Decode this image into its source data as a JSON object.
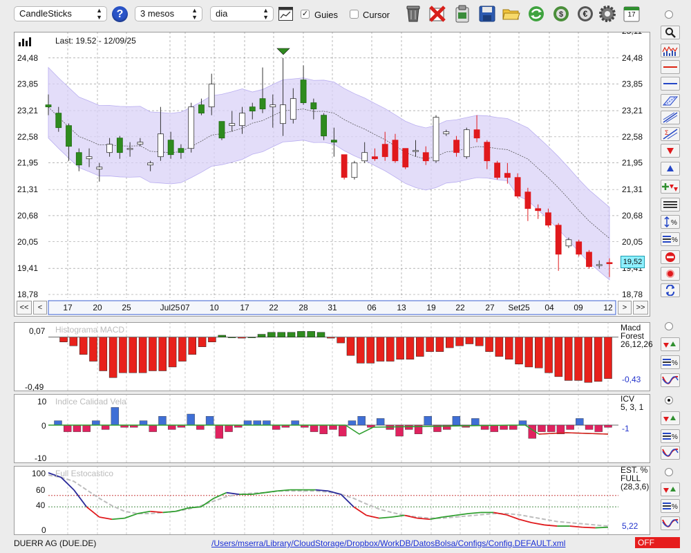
{
  "toolbar": {
    "chart_type": "CandleSticks",
    "period": "3 mesos",
    "interval": "dia",
    "guides_label": "Guies",
    "guides_checked": true,
    "cursor_label": "Cursor",
    "cursor_checked": false,
    "calendar_day": "17"
  },
  "main_chart": {
    "last_label": "Last: 19.52 - 12/09/25",
    "price_badge": "19,52",
    "y_ticks": [
      "24,48",
      "23,85",
      "23,21",
      "22,58",
      "21,95",
      "21,31",
      "20,68",
      "20,05",
      "19,41",
      "18,78"
    ],
    "y_top_partial": "25,11",
    "x_ticks": [
      "17",
      "20",
      "25",
      "Jul25",
      "07",
      "10",
      "17",
      "22",
      "28",
      "31",
      "06",
      "13",
      "19",
      "22",
      "27",
      "Set25",
      "04",
      "09",
      "12"
    ],
    "nav": {
      "first": "<<",
      "prev": "<",
      "next": ">",
      "last": ">>"
    }
  },
  "macd": {
    "title": "Histograma MACD",
    "top": "0,07",
    "bottom": "-0,49",
    "legend1": "Macd",
    "legend2": "Forest",
    "params": "26,12,26",
    "value": "-0,43"
  },
  "icv": {
    "title": "Indice Calidad Vela",
    "ticks": [
      "10",
      "0",
      "-10"
    ],
    "legend1": "ICV",
    "params": "5, 3, 1",
    "value": "-1"
  },
  "stoch": {
    "title": "Full Estocastico",
    "ticks": [
      "100",
      "60",
      "40",
      "0"
    ],
    "legend1": "EST. %",
    "legend2": "FULL",
    "params": "(28,3,6)",
    "value": "5,22"
  },
  "status": {
    "ticker": "DUERR AG (DUE.DE)",
    "path": "/Users/mserra/Library/CloudStorage/Dropbox/WorkDB/DatosBolsa/Configs/Config.DEFAULT.xml",
    "off": "OFF"
  },
  "colors": {
    "up": "#2e8b1e",
    "down": "#e0191c",
    "band": "#d9d2f7",
    "macd": "#e8211b",
    "icv_pos": "#3f6fd6",
    "icv_neg": "#e0225f"
  },
  "chart_data": [
    {
      "type": "candlestick",
      "ylim": [
        18.78,
        25.11
      ],
      "candles": [
        {
          "o": 23.35,
          "c": 23.3,
          "h": 23.6,
          "l": 23.1
        },
        {
          "o": 23.15,
          "c": 22.8,
          "h": 23.3,
          "l": 22.7
        },
        {
          "o": 22.85,
          "c": 22.35,
          "h": 22.9,
          "l": 22.0
        },
        {
          "o": 22.2,
          "c": 21.9,
          "h": 22.3,
          "l": 21.75
        },
        {
          "o": 22.05,
          "c": 22.1,
          "h": 22.3,
          "l": 21.85
        },
        {
          "o": 21.8,
          "c": 21.85,
          "h": 21.95,
          "l": 21.5
        },
        {
          "o": 22.2,
          "c": 22.4,
          "h": 22.55,
          "l": 22.1
        },
        {
          "o": 22.55,
          "c": 22.2,
          "h": 22.6,
          "l": 22.05
        },
        {
          "o": 22.3,
          "c": 22.3,
          "h": 22.45,
          "l": 22.1
        },
        {
          "o": 22.4,
          "c": 22.45,
          "h": 22.55,
          "l": 22.35
        },
        {
          "o": 21.9,
          "c": 21.95,
          "h": 22.0,
          "l": 21.75
        },
        {
          "o": 22.1,
          "c": 22.65,
          "h": 23.3,
          "l": 22.0
        },
        {
          "o": 22.5,
          "c": 22.15,
          "h": 22.7,
          "l": 22.05
        },
        {
          "o": 22.3,
          "c": 22.2,
          "h": 22.4,
          "l": 22.05
        },
        {
          "o": 22.3,
          "c": 23.3,
          "h": 23.4,
          "l": 22.2
        },
        {
          "o": 23.35,
          "c": 23.15,
          "h": 23.5,
          "l": 23.1
        },
        {
          "o": 23.3,
          "c": 23.85,
          "h": 24.1,
          "l": 23.1
        },
        {
          "o": 22.95,
          "c": 22.55,
          "h": 22.9,
          "l": 22.5
        },
        {
          "o": 22.85,
          "c": 22.9,
          "h": 23.2,
          "l": 22.7
        },
        {
          "o": 22.85,
          "c": 23.15,
          "h": 23.3,
          "l": 22.65
        },
        {
          "o": 23.3,
          "c": 23.2,
          "h": 23.4,
          "l": 23.0
        },
        {
          "o": 23.5,
          "c": 23.25,
          "h": 24.25,
          "l": 23.15
        },
        {
          "o": 23.3,
          "c": 23.35,
          "h": 23.6,
          "l": 22.8
        },
        {
          "o": 22.9,
          "c": 23.35,
          "h": 24.48,
          "l": 22.6
        },
        {
          "o": 23.0,
          "c": 23.5,
          "h": 23.75,
          "l": 22.9
        },
        {
          "o": 23.95,
          "c": 23.4,
          "h": 24.3,
          "l": 23.35
        },
        {
          "o": 23.4,
          "c": 23.25,
          "h": 23.5,
          "l": 23.0
        },
        {
          "o": 23.1,
          "c": 22.6,
          "h": 23.15,
          "l": 22.5
        },
        {
          "o": 22.5,
          "c": 22.45,
          "h": 22.8,
          "l": 22.1
        },
        {
          "o": 22.15,
          "c": 21.6,
          "h": 22.15,
          "l": 21.55
        },
        {
          "o": 21.6,
          "c": 21.95,
          "h": 22.0,
          "l": 21.55
        },
        {
          "o": 22.0,
          "c": 22.2,
          "h": 22.45,
          "l": 21.95
        },
        {
          "o": 22.1,
          "c": 22.05,
          "h": 22.3,
          "l": 22.0
        },
        {
          "o": 22.4,
          "c": 22.1,
          "h": 22.7,
          "l": 22.0
        },
        {
          "o": 22.5,
          "c": 22.0,
          "h": 22.65,
          "l": 21.95
        },
        {
          "o": 22.3,
          "c": 21.85,
          "h": 22.3,
          "l": 21.8
        },
        {
          "o": 22.25,
          "c": 22.25,
          "h": 22.5,
          "l": 22.1
        },
        {
          "o": 22.2,
          "c": 22.0,
          "h": 22.35,
          "l": 21.9
        },
        {
          "o": 22.0,
          "c": 23.05,
          "h": 23.1,
          "l": 21.95
        },
        {
          "o": 22.65,
          "c": 22.7,
          "h": 22.75,
          "l": 22.6
        },
        {
          "o": 22.5,
          "c": 22.2,
          "h": 22.6,
          "l": 22.1
        },
        {
          "o": 22.1,
          "c": 22.75,
          "h": 22.8,
          "l": 22.05
        },
        {
          "o": 22.75,
          "c": 22.55,
          "h": 23.1,
          "l": 22.45
        },
        {
          "o": 22.45,
          "c": 22.0,
          "h": 22.5,
          "l": 21.8
        },
        {
          "o": 21.95,
          "c": 21.6,
          "h": 22.0,
          "l": 21.55
        },
        {
          "o": 21.7,
          "c": 21.6,
          "h": 21.95,
          "l": 21.45
        },
        {
          "o": 21.6,
          "c": 21.15,
          "h": 21.7,
          "l": 21.1
        },
        {
          "o": 21.25,
          "c": 20.85,
          "h": 21.35,
          "l": 20.55
        },
        {
          "o": 20.85,
          "c": 20.8,
          "h": 20.95,
          "l": 20.6
        },
        {
          "o": 20.75,
          "c": 20.45,
          "h": 20.85,
          "l": 20.4
        },
        {
          "o": 20.45,
          "c": 19.75,
          "h": 20.5,
          "l": 19.35
        },
        {
          "o": 19.95,
          "c": 20.1,
          "h": 20.15,
          "l": 19.9
        },
        {
          "o": 20.05,
          "c": 19.75,
          "h": 20.1,
          "l": 19.7
        },
        {
          "o": 19.8,
          "c": 19.45,
          "h": 19.85,
          "l": 19.4
        },
        {
          "o": 19.5,
          "c": 19.5,
          "h": 19.6,
          "l": 19.4
        },
        {
          "o": 19.55,
          "c": 19.52,
          "h": 19.65,
          "l": 19.2
        }
      ]
    },
    {
      "type": "bar",
      "title": "Histograma MACD",
      "ylim": [
        -0.49,
        0.07
      ],
      "values": [
        -0.05,
        -0.09,
        -0.18,
        -0.25,
        -0.35,
        -0.42,
        -0.37,
        -0.37,
        -0.37,
        -0.35,
        -0.35,
        -0.31,
        -0.25,
        -0.18,
        -0.1,
        -0.05,
        0.02,
        0.0,
        -0.01,
        0.0,
        0.03,
        0.05,
        0.05,
        0.05,
        0.06,
        0.06,
        0.05,
        -0.01,
        -0.06,
        -0.19,
        -0.27,
        -0.27,
        -0.25,
        -0.25,
        -0.23,
        -0.23,
        -0.2,
        -0.15,
        -0.15,
        -0.11,
        -0.09,
        -0.07,
        -0.09,
        -0.15,
        -0.2,
        -0.23,
        -0.28,
        -0.31,
        -0.32,
        -0.37,
        -0.41,
        -0.45,
        -0.45,
        -0.47,
        -0.46,
        -0.43
      ]
    },
    {
      "type": "bar",
      "title": "Indice Calidad Vela",
      "ylim": [
        -10,
        10
      ],
      "values": [
        2,
        -3,
        -3,
        -3,
        2,
        -2,
        8,
        -1,
        -1,
        2,
        -3,
        4,
        -2,
        -1,
        5,
        -2,
        4,
        -6,
        -3,
        -1,
        2,
        2,
        2,
        -2,
        -1,
        2,
        -1,
        -3,
        -4,
        -2,
        -5,
        2,
        4,
        -1,
        3,
        -2,
        -5,
        -2,
        -4,
        4,
        -3,
        -2,
        4,
        -1,
        3,
        -2,
        -3,
        -2,
        -2,
        2,
        -6,
        -3,
        -3,
        -4,
        -2,
        3,
        -2,
        -3,
        -1
      ]
    },
    {
      "type": "line",
      "title": "Full Estocastico",
      "ylim": [
        0,
        100
      ],
      "series": [
        {
          "values": [
            100,
            92,
            70,
            40,
            22,
            18,
            20,
            28,
            32,
            30,
            32,
            38,
            40,
            55,
            65,
            62,
            62,
            65,
            68,
            70,
            70,
            70,
            68,
            62,
            40,
            25,
            20,
            22,
            25,
            20,
            18,
            22,
            25,
            28,
            30,
            30,
            26,
            18,
            12,
            8,
            6,
            6,
            4,
            3,
            4
          ]
        },
        {
          "values": [
            96,
            92,
            85,
            70,
            55,
            42,
            32,
            28,
            28,
            30,
            32,
            36,
            42,
            50,
            58,
            62,
            64,
            65,
            68,
            68,
            68,
            68,
            66,
            62,
            55,
            45,
            36,
            30,
            25,
            22,
            20,
            20,
            22,
            24,
            26,
            28,
            28,
            26,
            22,
            18,
            14,
            12,
            10,
            8,
            6
          ]
        }
      ]
    }
  ]
}
